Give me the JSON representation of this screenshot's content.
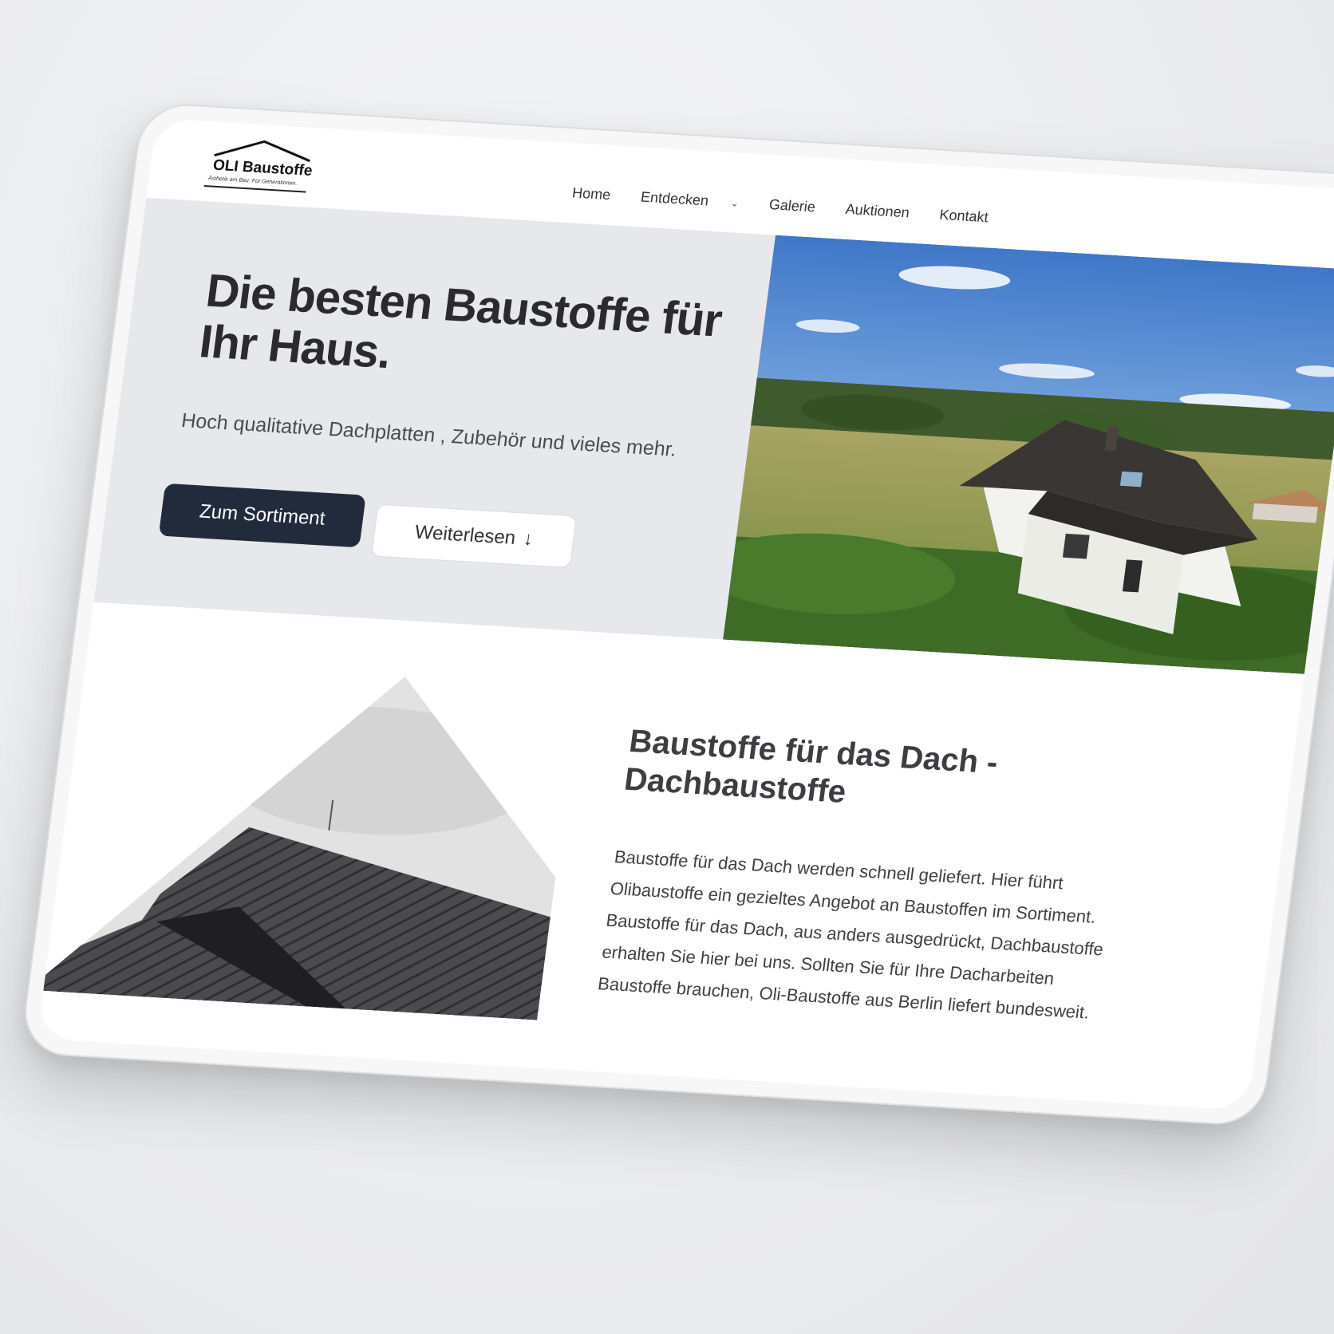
{
  "header": {
    "logo_name": "OLI Baustoffe",
    "logo_tagline": "Ästhetik am Bau. Für Generationen.",
    "nav": [
      {
        "label": "Home"
      },
      {
        "label": "Entdecken"
      },
      {
        "label": "Galerie"
      },
      {
        "label": "Auktionen"
      },
      {
        "label": "Kontakt"
      }
    ]
  },
  "hero": {
    "title": "Die besten Baustoffe für Ihr Haus.",
    "subtitle": "Hoch qualitative Dachplatten , Zubehör und vieles mehr.",
    "primary_button": "Zum Sortiment",
    "secondary_button": "Weiterlesen",
    "secondary_icon": "arrow-down-icon",
    "image_icon": "house-photo"
  },
  "section": {
    "title": "Baustoffe für das Dach - Dachbaustoffe",
    "body": "Baustoffe für das Dach werden schnell geliefert. Hier führt Olibaustoffe ein gezieltes Angebot an Baustoffen im Sortiment. Baustoffe für das Dach, aus anders ausgedrückt, Dachbaustoffe erhalten Sie hier bei uns. Sollten Sie für Ihre Dacharbeiten Baustoffe brauchen, Oli-Baustoffe aus Berlin liefert bundesweit."
  },
  "colors": {
    "primary_button": "#222b3c",
    "hero_bg": "#e7e8ec",
    "text_dark": "#2b2b2e"
  }
}
